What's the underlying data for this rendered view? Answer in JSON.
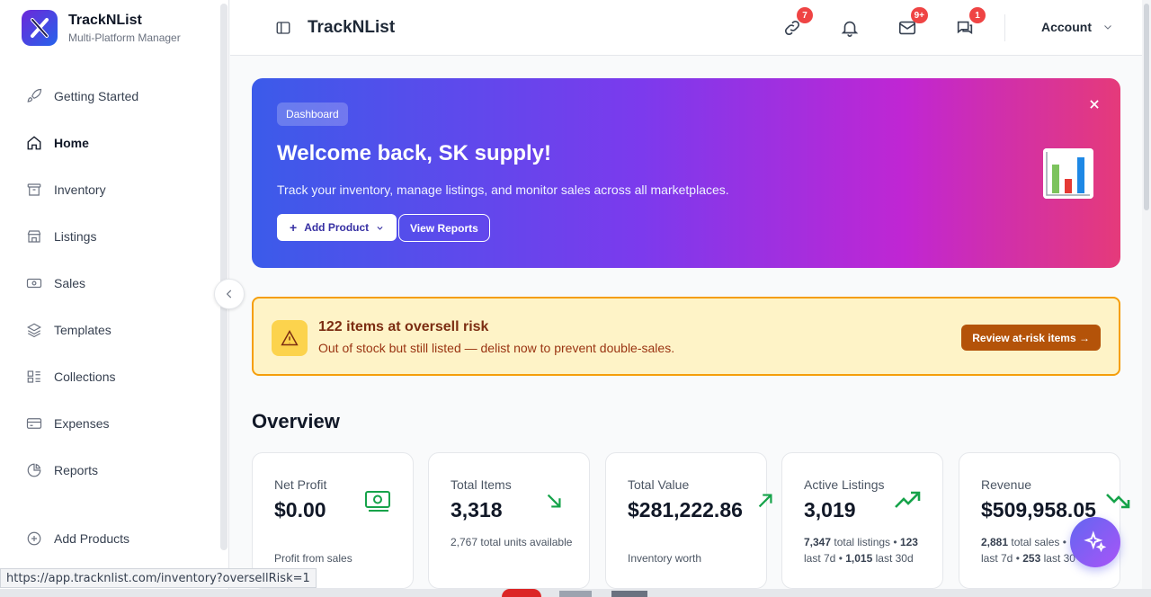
{
  "brand": {
    "name": "TrackNList",
    "subtitle": "Multi-Platform Manager"
  },
  "sidebar": {
    "items": [
      {
        "label": "Getting Started",
        "icon": "rocket-icon"
      },
      {
        "label": "Home",
        "icon": "home-icon",
        "active": true
      },
      {
        "label": "Inventory",
        "icon": "archive-icon"
      },
      {
        "label": "Listings",
        "icon": "store-icon"
      },
      {
        "label": "Sales",
        "icon": "banknote-icon"
      },
      {
        "label": "Templates",
        "icon": "layers-icon"
      },
      {
        "label": "Collections",
        "icon": "collection-icon"
      },
      {
        "label": "Expenses",
        "icon": "credit-card-icon"
      },
      {
        "label": "Reports",
        "icon": "pie-chart-icon"
      }
    ],
    "add_products": "Add Products"
  },
  "header": {
    "title": "TrackNList",
    "badges": {
      "links": "7",
      "mail": "9+",
      "chat": "1"
    },
    "account": "Account"
  },
  "hero": {
    "chip": "Dashboard",
    "title": "Welcome back, SK supply!",
    "description": "Track your inventory, manage listings, and monitor sales across all marketplaces.",
    "add_product": "Add Product",
    "view_reports": "View Reports"
  },
  "alert": {
    "title": "122 items at oversell risk",
    "description": "Out of stock but still listed — delist now to prevent double-sales.",
    "button": "Review at-risk items →"
  },
  "overview": {
    "title": "Overview"
  },
  "cards": [
    {
      "label": "Net Profit",
      "value": "$0.00",
      "sub": "Profit from sales"
    },
    {
      "label": "Total Items",
      "value": "3,318",
      "sub": "2,767 total units available"
    },
    {
      "label": "Total Value",
      "value": "$281,222.86",
      "sub": "Inventory worth"
    },
    {
      "label": "Active Listings",
      "value": "3,019",
      "sub_a": "7,347",
      "sub_b": " total listings • ",
      "sub_c": "123",
      "sub_d": " last 7d • ",
      "sub_e": "1,015",
      "sub_f": " last 30d"
    },
    {
      "label": "Revenue",
      "value": "$509,958.05",
      "sub_a": "2,881",
      "sub_b": " total sales • ",
      "sub_d": "last 7d • ",
      "sub_e": "253",
      "sub_f": " last 30"
    }
  ],
  "status_url": "https://app.tracknlist.com/inventory?oversellRisk=1",
  "colors": {
    "accent": "#4f46e5",
    "success": "#16a34a",
    "warning": "#f59e0b",
    "danger": "#ef4444"
  }
}
